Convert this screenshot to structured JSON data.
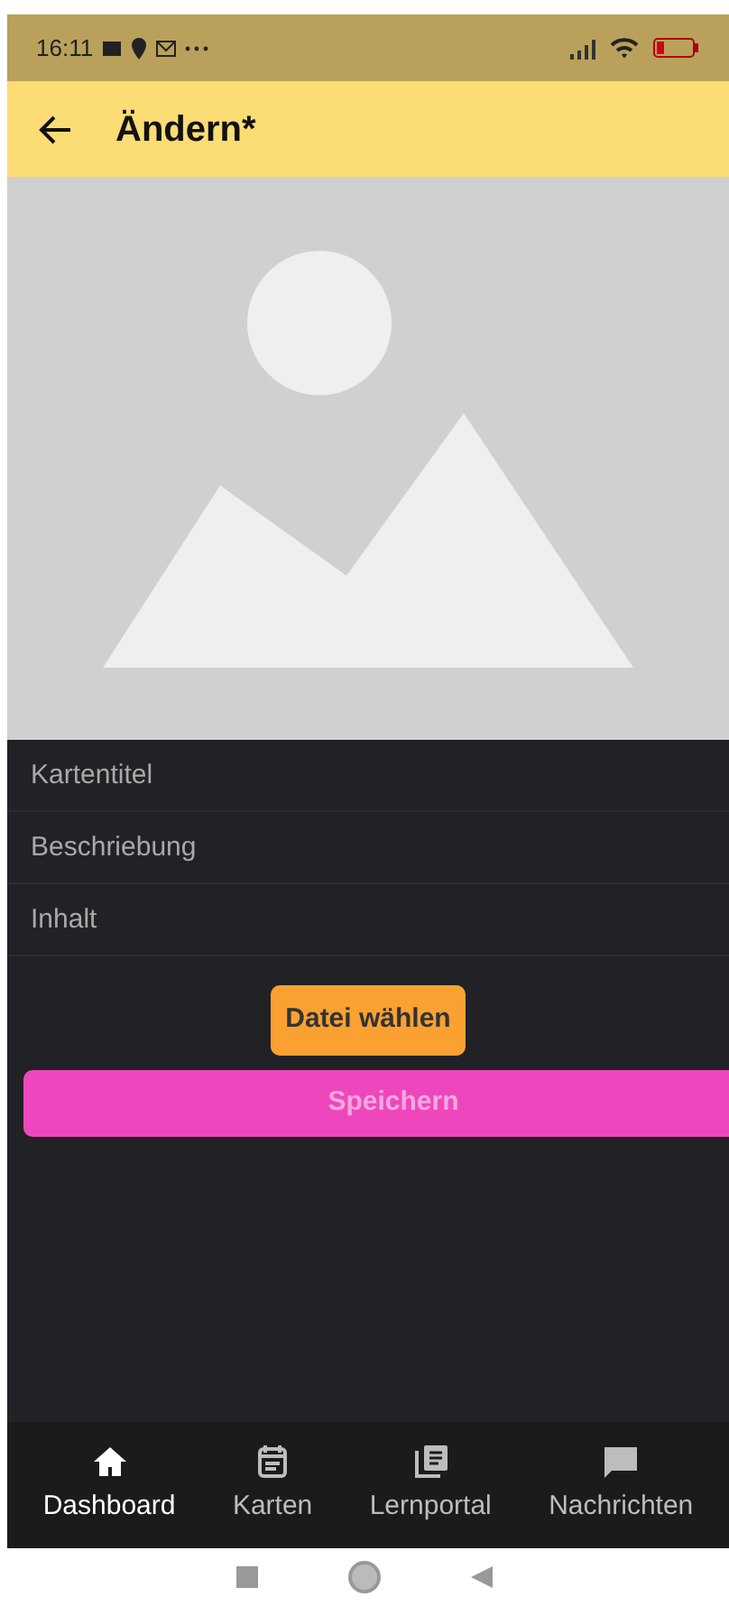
{
  "status_bar": {
    "time": "16:11"
  },
  "app_bar": {
    "title": "Ändern*"
  },
  "image": {
    "kind": "placeholder"
  },
  "fields": [
    {
      "placeholder": "Kartentitel"
    },
    {
      "placeholder": "Beschriebung"
    },
    {
      "placeholder": "Inhalt"
    }
  ],
  "file_button": "Datei wählen",
  "save_button": {
    "label": "Speichern",
    "disabled": true
  },
  "bottom_nav": [
    {
      "label": "Dashboard",
      "selected": true
    },
    {
      "label": "Karten",
      "selected": false
    },
    {
      "label": "Lernportal",
      "selected": false
    },
    {
      "label": "Nachrichten",
      "selected": false
    }
  ]
}
